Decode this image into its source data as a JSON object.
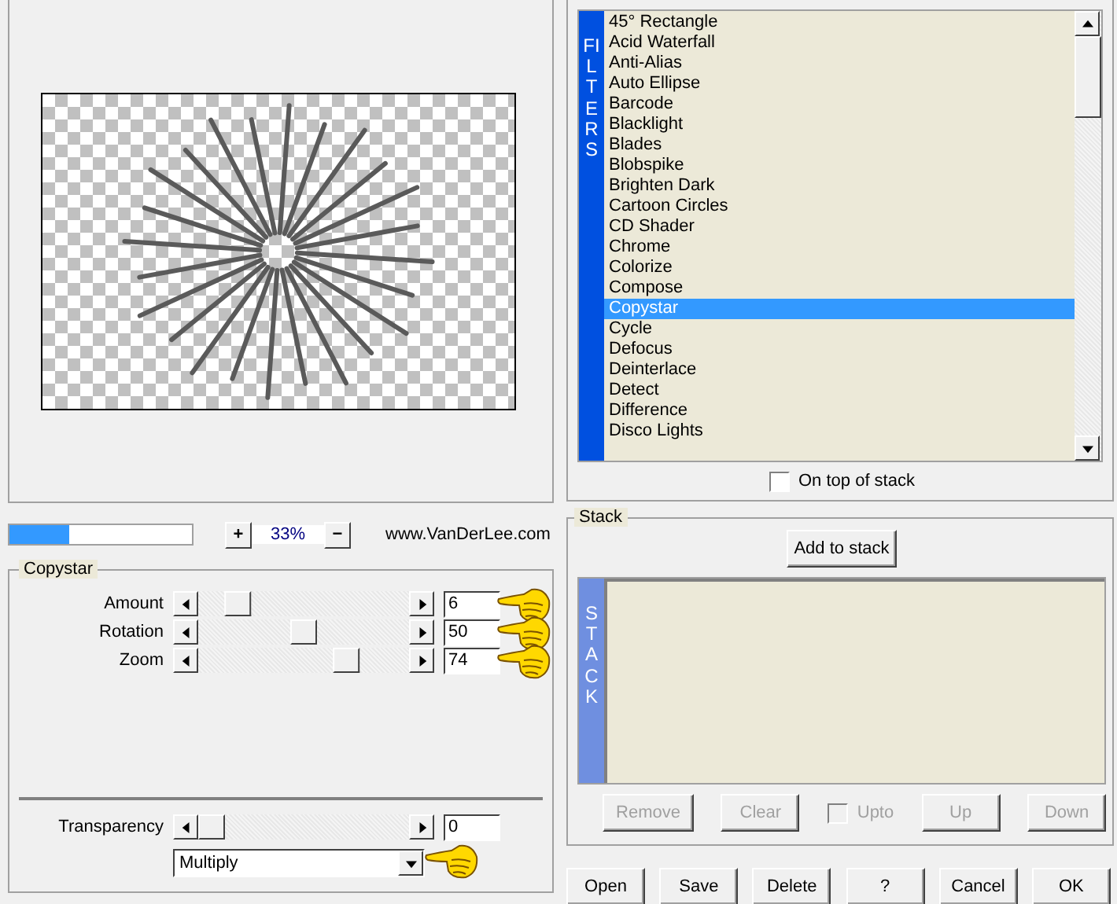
{
  "zoom": {
    "level": 0.33,
    "reading": "33%",
    "plus": "+",
    "minus": "−",
    "site": "www.VanDerLee.com"
  },
  "filter_group": {
    "title": "Copystar",
    "sliders": [
      {
        "label": "Amount",
        "level": 0.14,
        "value": "6",
        "pointer": true
      },
      {
        "label": "Rotation",
        "level": 0.5,
        "value": "50",
        "pointer": true
      },
      {
        "label": "Zoom",
        "level": 0.73,
        "value": "74",
        "pointer": true
      }
    ],
    "transparency": {
      "label": "Transparency",
      "level": 0,
      "value": "0"
    },
    "blend": {
      "value": "Multiply",
      "pointer": true
    }
  },
  "filters": {
    "side_label": "FILTERS",
    "items": [
      {
        "label": "45° Rectangle",
        "selected": false
      },
      {
        "label": "Acid Waterfall",
        "selected": false
      },
      {
        "label": "Anti-Alias",
        "selected": false
      },
      {
        "label": "Auto Ellipse",
        "selected": false
      },
      {
        "label": "Barcode",
        "selected": false
      },
      {
        "label": "Blacklight",
        "selected": false
      },
      {
        "label": "Blades",
        "selected": false
      },
      {
        "label": "Blobspike",
        "selected": false
      },
      {
        "label": "Brighten Dark",
        "selected": false
      },
      {
        "label": "Cartoon Circles",
        "selected": false
      },
      {
        "label": "CD Shader",
        "selected": false
      },
      {
        "label": "Chrome",
        "selected": false
      },
      {
        "label": "Colorize",
        "selected": false
      },
      {
        "label": "Compose",
        "selected": false
      },
      {
        "label": "Copystar",
        "selected": true
      },
      {
        "label": "Cycle",
        "selected": false
      },
      {
        "label": "Defocus",
        "selected": false
      },
      {
        "label": "Deinterlace",
        "selected": false
      },
      {
        "label": "Detect",
        "selected": false
      },
      {
        "label": "Difference",
        "selected": false
      },
      {
        "label": "Disco Lights",
        "selected": false
      }
    ],
    "on_top": {
      "label": "On top of stack",
      "checked": false
    }
  },
  "stack": {
    "title": "Stack",
    "add": "Add to stack",
    "side_label": "STACK",
    "buttons": [
      {
        "label": "Remove",
        "disabled": true
      },
      {
        "label": "Clear",
        "disabled": true
      }
    ],
    "upto": {
      "label": "Upto",
      "checked": false,
      "disabled": true
    },
    "buttons_right": [
      {
        "label": "Up",
        "disabled": true
      },
      {
        "label": "Down",
        "disabled": true
      }
    ]
  },
  "footer_buttons": [
    "Open",
    "Save",
    "Delete",
    "?",
    "Cancel",
    "OK"
  ]
}
